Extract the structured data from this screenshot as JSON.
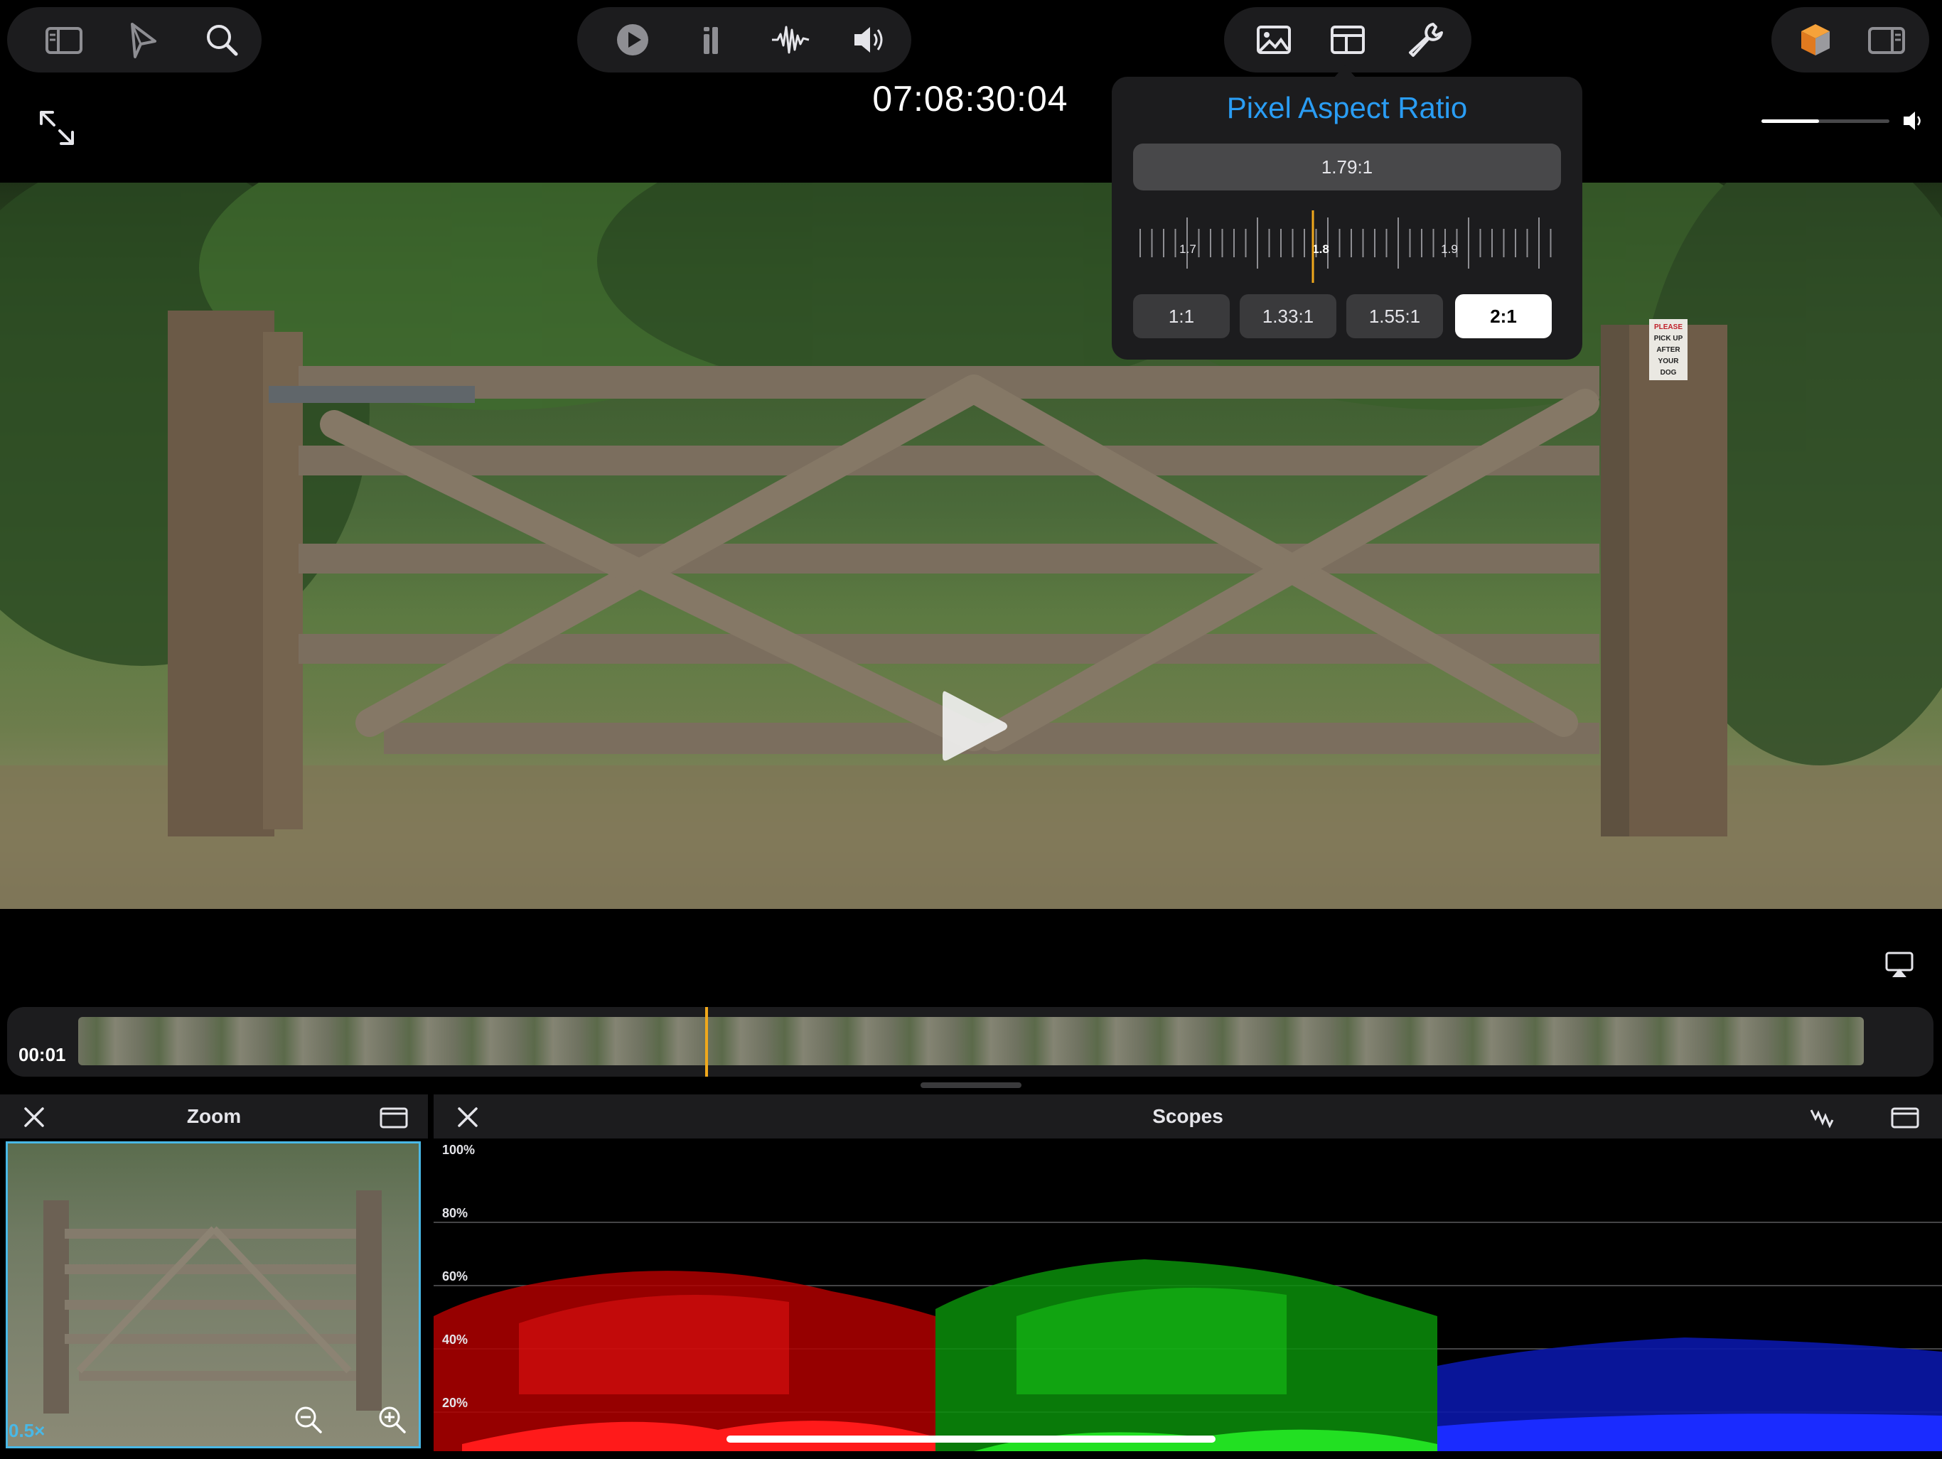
{
  "toolbar": {
    "left_group": [
      "sidebar-icon",
      "navigate-icon",
      "search-icon"
    ],
    "center_group": [
      "play-circle-icon",
      "bars-icon",
      "waveform-icon",
      "speaker-icon"
    ],
    "right_group": [
      "image-icon",
      "layout-icon",
      "wrench-icon"
    ],
    "far_right_group": [
      "cube-icon",
      "inspector-icon"
    ]
  },
  "timecode": "07:08:30:04",
  "volume_level": 0.45,
  "popover": {
    "title": "Pixel Aspect Ratio",
    "value": "1.79:1",
    "ruler_labels": [
      "1.7",
      "1.8",
      "1.9"
    ],
    "presets": [
      "1:1",
      "1.33:1",
      "1.55:1",
      "2:1"
    ],
    "selected_preset": "2:1"
  },
  "sign_text": [
    "PLEASE",
    "PICK UP",
    "AFTER",
    "YOUR",
    "DOG"
  ],
  "filmstrip": {
    "time_label": "00:01",
    "playhead_color": "#f0a81c"
  },
  "zoom_panel": {
    "title": "Zoom",
    "zoom_level": "0.5×"
  },
  "scopes_panel": {
    "title": "Scopes",
    "scale_labels": [
      "100%",
      "80%",
      "60%",
      "40%",
      "20%"
    ]
  },
  "colors": {
    "accent": "#2a9df4",
    "zoom_border": "#49b8e6",
    "panel_bg": "#1c1c1e"
  }
}
